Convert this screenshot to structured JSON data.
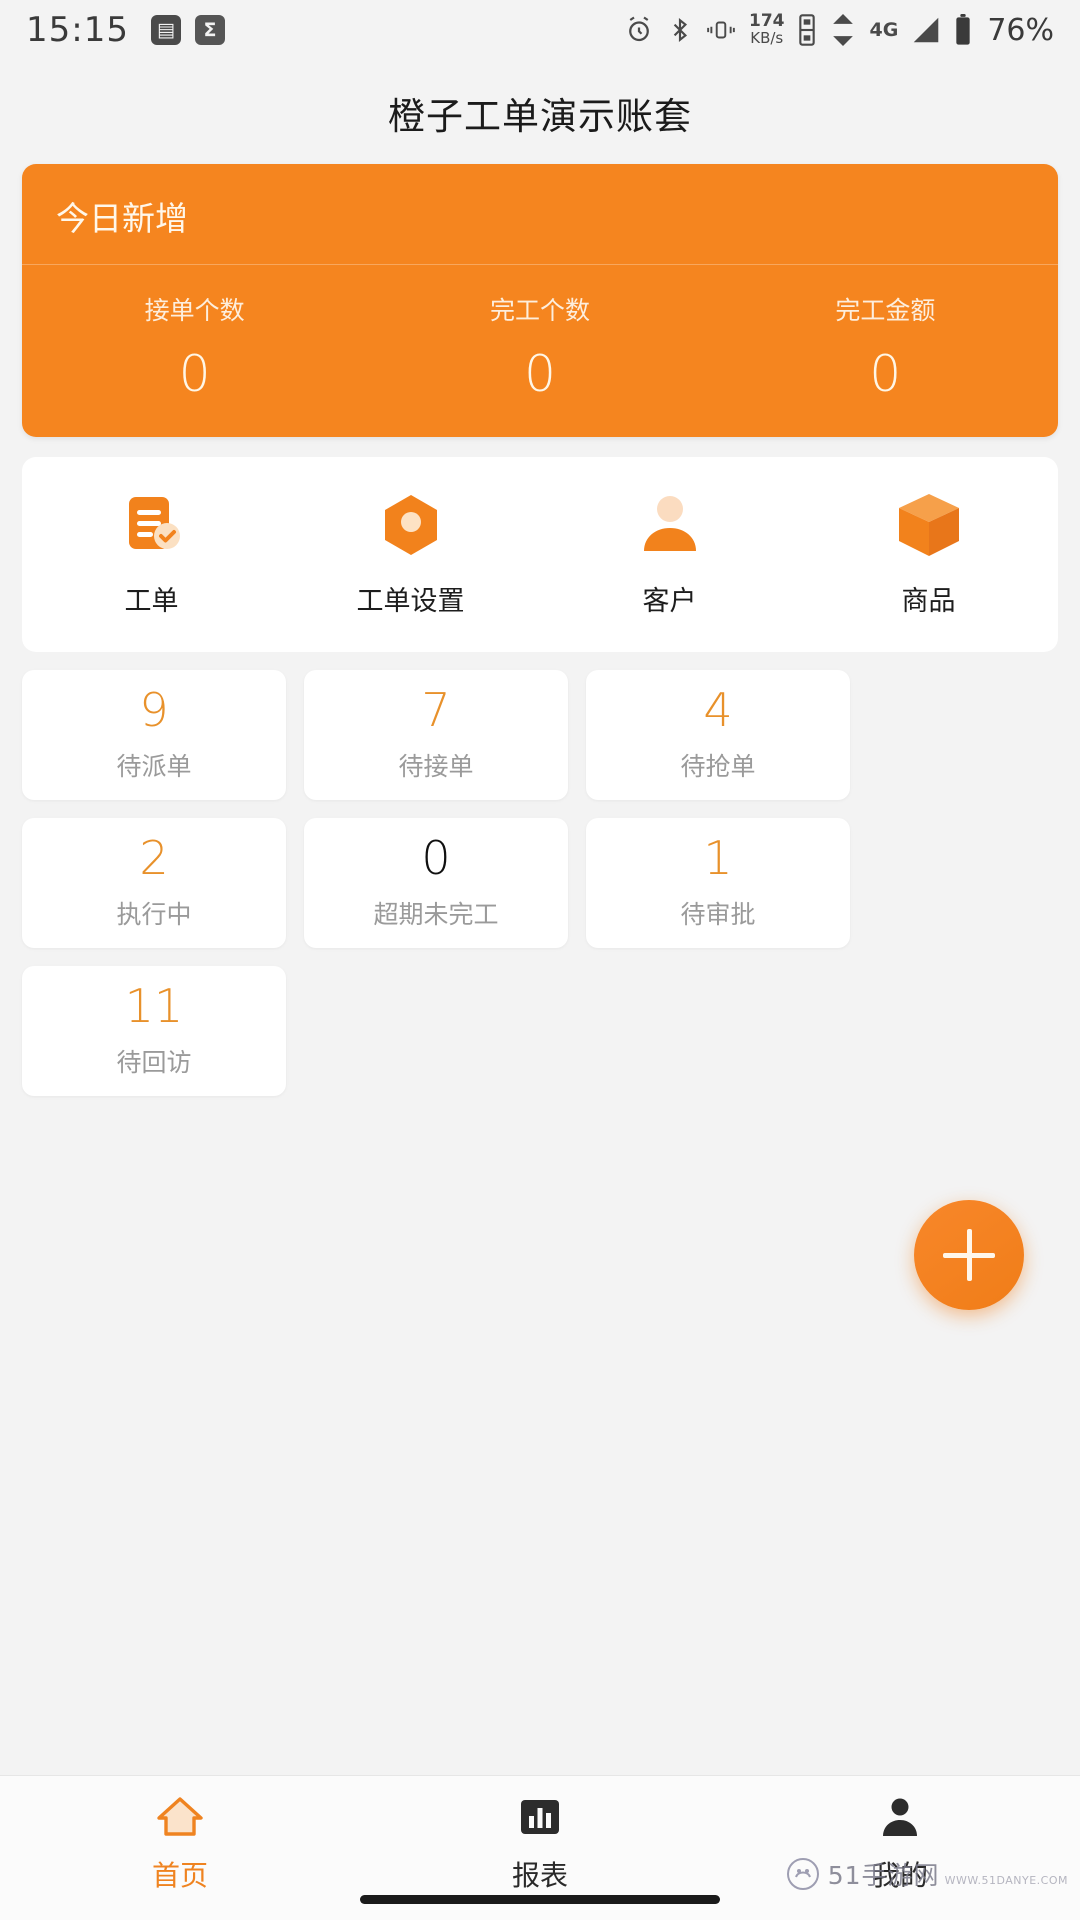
{
  "statusbar": {
    "time": "15:15",
    "left_icons": [
      "notification-badge-icon",
      "sigma-app-icon"
    ],
    "right_icons": [
      "alarm-icon",
      "bluetooth-icon",
      "vibrate-icon",
      "data-speed-icon",
      "sim-icon",
      "nfc-icon",
      "wifi-icon",
      "network-4g-icon",
      "signal-icon",
      "battery-icon"
    ],
    "data_rate_value": "174",
    "data_rate_unit": "KB/s",
    "network": "4G",
    "battery": "76%"
  },
  "header": {
    "title": "橙子工单演示账套"
  },
  "summary": {
    "heading": "今日新增",
    "stats": [
      {
        "label": "接单个数",
        "value": "0"
      },
      {
        "label": "完工个数",
        "value": "0"
      },
      {
        "label": "完工金额",
        "value": "0"
      }
    ]
  },
  "shortcuts": [
    {
      "label": "工单",
      "icon": "work-order-icon"
    },
    {
      "label": "工单设置",
      "icon": "work-order-settings-icon"
    },
    {
      "label": "客户",
      "icon": "customer-icon"
    },
    {
      "label": "商品",
      "icon": "product-box-icon"
    }
  ],
  "tiles": [
    {
      "value": "9",
      "label": "待派单",
      "accent": true
    },
    {
      "value": "7",
      "label": "待接单",
      "accent": true
    },
    {
      "value": "4",
      "label": "待抢单",
      "accent": true
    },
    {
      "value": "2",
      "label": "执行中",
      "accent": true
    },
    {
      "value": "0",
      "label": "超期未完工",
      "accent": false
    },
    {
      "value": "1",
      "label": "待审批",
      "accent": true
    },
    {
      "value": "11",
      "label": "待回访",
      "accent": true
    }
  ],
  "fab": {
    "icon": "plus-icon",
    "label": "新增"
  },
  "bottomnav": [
    {
      "label": "首页",
      "icon": "home-icon",
      "active": true
    },
    {
      "label": "报表",
      "icon": "chart-icon",
      "active": false
    },
    {
      "label": "我的",
      "icon": "person-icon",
      "active": false
    }
  ],
  "watermark": {
    "text": "51手游网",
    "sub": "WWW.51DANYE.COM"
  },
  "colors": {
    "brand_orange": "#f5851f",
    "accent_number": "#e8912b",
    "page_bg": "#f3f3f3",
    "card_bg": "#ffffff",
    "muted_text": "#9a9a9a"
  }
}
